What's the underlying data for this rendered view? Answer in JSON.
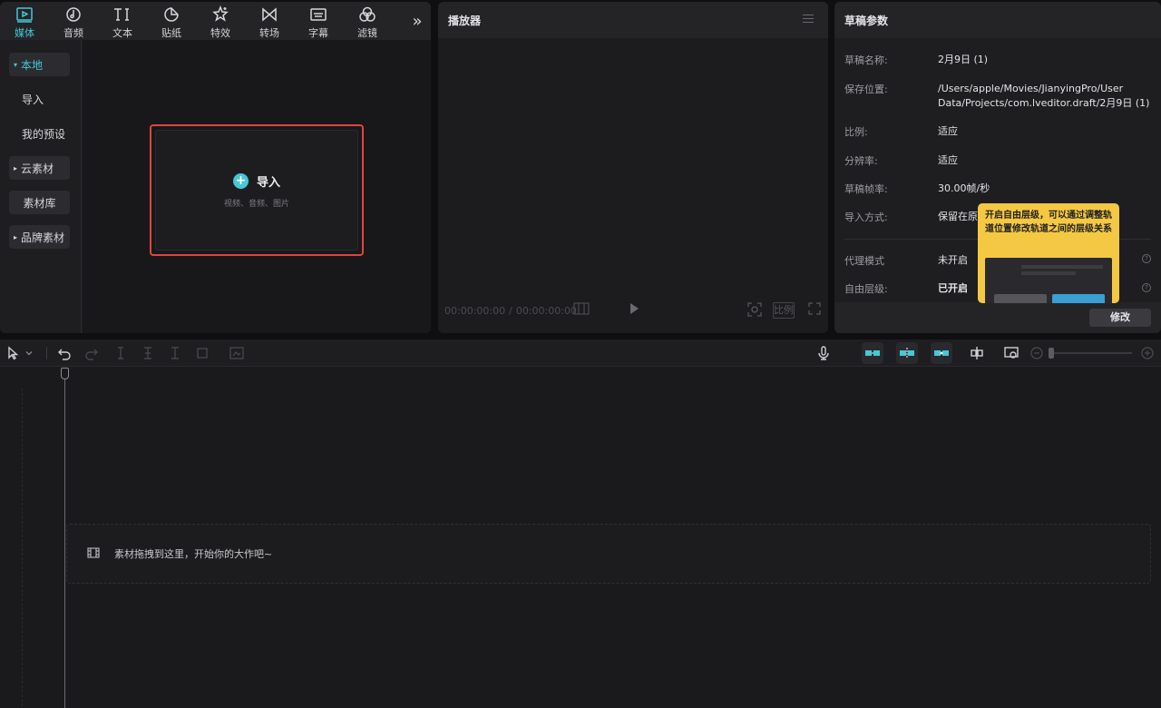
{
  "media_tabs": [
    {
      "label": "媒体",
      "icon": "media-icon",
      "active": true
    },
    {
      "label": "音频",
      "icon": "audio-icon"
    },
    {
      "label": "文本",
      "icon": "text-icon"
    },
    {
      "label": "贴纸",
      "icon": "sticker-icon"
    },
    {
      "label": "特效",
      "icon": "effects-icon"
    },
    {
      "label": "转场",
      "icon": "transition-icon"
    },
    {
      "label": "字幕",
      "icon": "subtitle-icon"
    },
    {
      "label": "滤镜",
      "icon": "filter-icon"
    }
  ],
  "sidebar": {
    "local": "本地",
    "import": "导入",
    "presets": "我的预设",
    "cloud": "云素材",
    "library": "素材库",
    "brand": "品牌素材"
  },
  "import_card": {
    "label": "导入",
    "hint": "视频、音频、图片"
  },
  "player": {
    "title": "播放器",
    "timecode_current": "00:00:00:00",
    "timecode_sep": "/",
    "timecode_total": "00:00:00:00",
    "ratio_label": "比例"
  },
  "draft": {
    "title": "草稿参数",
    "name_key": "草稿名称:",
    "name_val": "2月9日 (1)",
    "location_key": "保存位置:",
    "location_val": "/Users/apple/Movies/JianyingPro/User Data/Projects/com.lveditor.draft/2月9日 (1)",
    "ratio_key": "比例:",
    "ratio_val": "适应",
    "resolution_key": "分辨率:",
    "resolution_val": "适应",
    "fps_key": "草稿帧率:",
    "fps_val": "30.00帧/秒",
    "import_key": "导入方式:",
    "import_val": "保留在原",
    "proxy_key": "代理模式",
    "proxy_val": "未开启",
    "layer_key": "自由层级:",
    "layer_val": "已开启",
    "modify_label": "修改"
  },
  "tooltip": {
    "text": "开启自由层级，可以通过调整轨道位置修改轨道之间的层级关系"
  },
  "timeline": {
    "drop_hint": "素材拖拽到这里，开始你的大作吧~"
  },
  "colors": {
    "accent": "#45c8d8",
    "highlight_border": "#e0453a",
    "tooltip_bg": "#f4c842"
  }
}
